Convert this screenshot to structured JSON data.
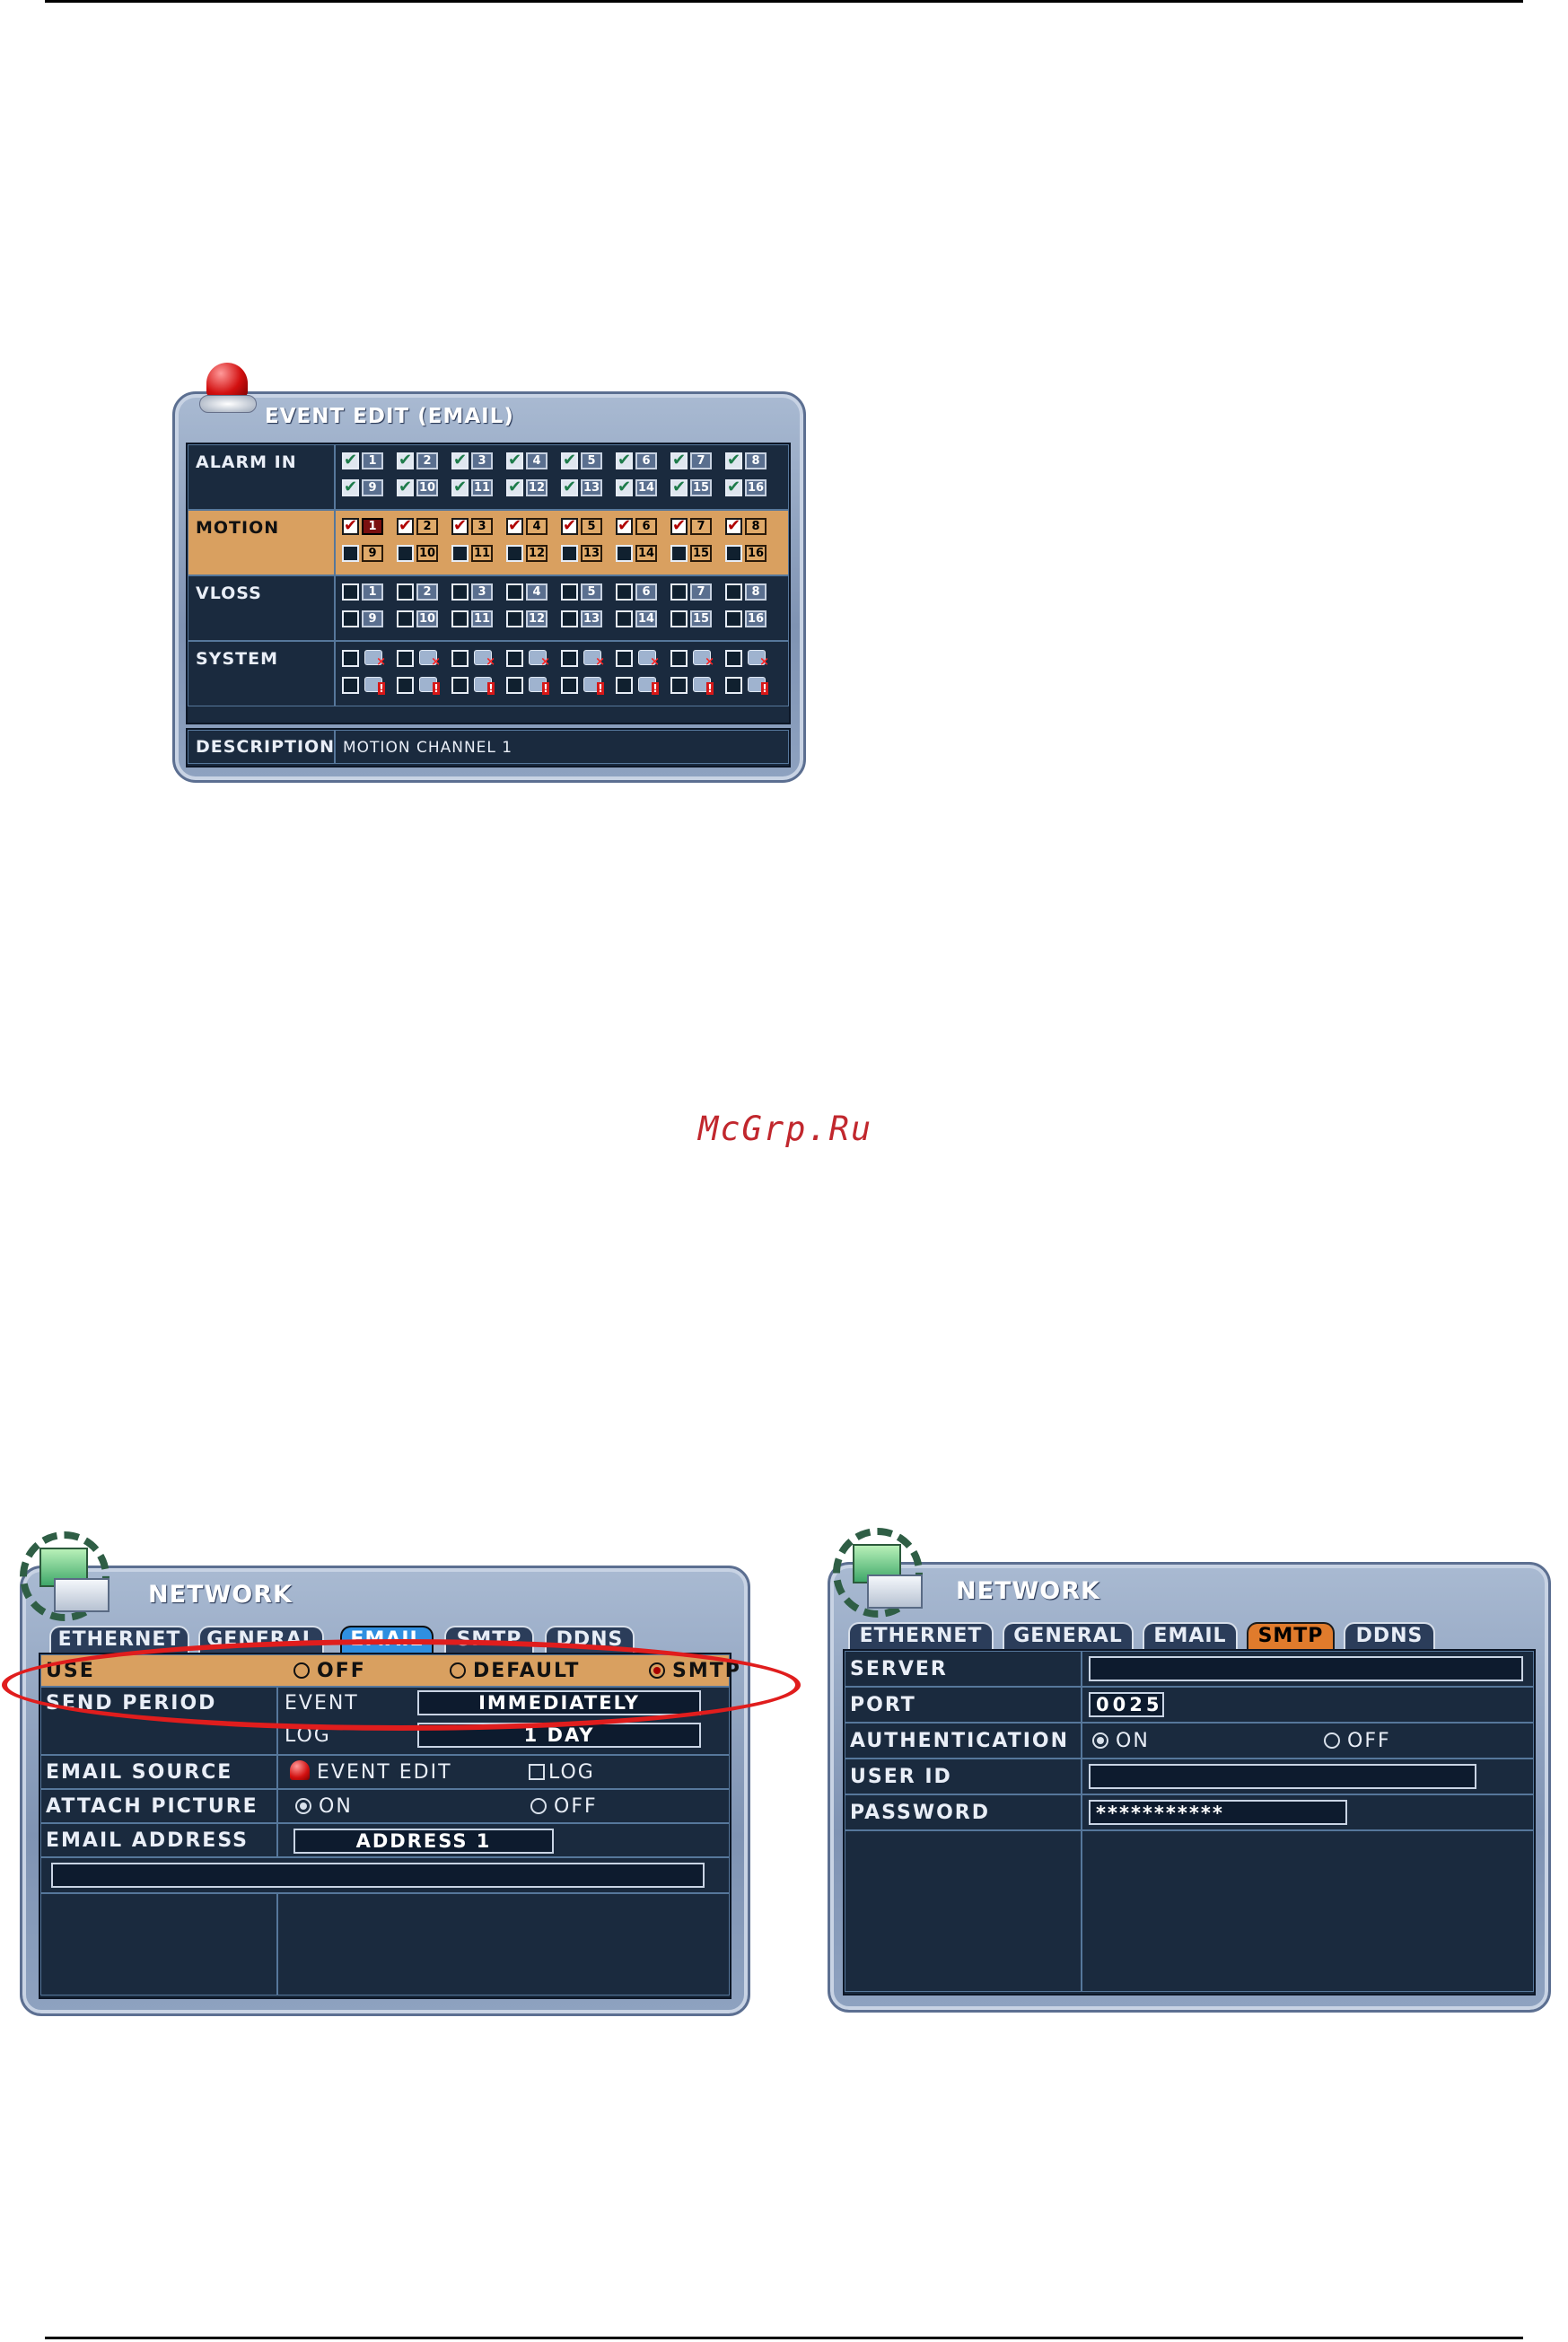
{
  "watermark": "McGrp.Ru",
  "event_edit": {
    "title": "EVENT EDIT (EMAIL)",
    "rows": [
      {
        "label": "ALARM IN"
      },
      {
        "label": "MOTION"
      },
      {
        "label": "VLOSS"
      },
      {
        "label": "SYSTEM"
      }
    ],
    "channels_row1": [
      "1",
      "2",
      "3",
      "4",
      "5",
      "6",
      "7",
      "8"
    ],
    "channels_row2": [
      "9",
      "10",
      "11",
      "12",
      "13",
      "14",
      "15",
      "16"
    ],
    "alarm_in_checked": "all",
    "motion_checked": "1-8",
    "vloss_checked": "none",
    "selected_row": "MOTION",
    "description_label": "DESCRIPTION",
    "description_value": "MOTION CHANNEL 1"
  },
  "network_email": {
    "title": "NETWORK",
    "tabs": [
      "ETHERNET",
      "GENERAL",
      "EMAIL",
      "SMTP",
      "DDNS"
    ],
    "active_tab": "EMAIL",
    "use": {
      "label": "USE",
      "options": [
        "OFF",
        "DEFAULT",
        "SMTP"
      ],
      "selected": "SMTP"
    },
    "send_period": {
      "label": "SEND PERIOD",
      "event_label": "EVENT",
      "event_value": "IMMEDIATELY",
      "log_label": "LOG",
      "log_value": "1 DAY"
    },
    "email_source": {
      "label": "EMAIL SOURCE",
      "event_edit": "EVENT EDIT",
      "log": "LOG"
    },
    "attach_picture": {
      "label": "ATTACH PICTURE",
      "on": "ON",
      "off": "OFF",
      "selected": "ON"
    },
    "email_address": {
      "label": "EMAIL ADDRESS",
      "value": "ADDRESS 1"
    }
  },
  "network_smtp": {
    "title": "NETWORK",
    "tabs": [
      "ETHERNET",
      "GENERAL",
      "EMAIL",
      "SMTP",
      "DDNS"
    ],
    "active_tab": "SMTP",
    "server_label": "SERVER",
    "server_value": "",
    "port_label": "PORT",
    "port_value": "0025",
    "auth_label": "AUTHENTICATION",
    "auth_on": "ON",
    "auth_off": "OFF",
    "auth_selected": "ON",
    "userid_label": "USER ID",
    "userid_value": "",
    "password_label": "PASSWORD",
    "password_value": "***********"
  },
  "colors": {
    "highlight_row": "#d9a060",
    "panel_dark": "#1a2a3e",
    "annotation_oval": "#e01d1d",
    "watermark": "#c1272d"
  }
}
